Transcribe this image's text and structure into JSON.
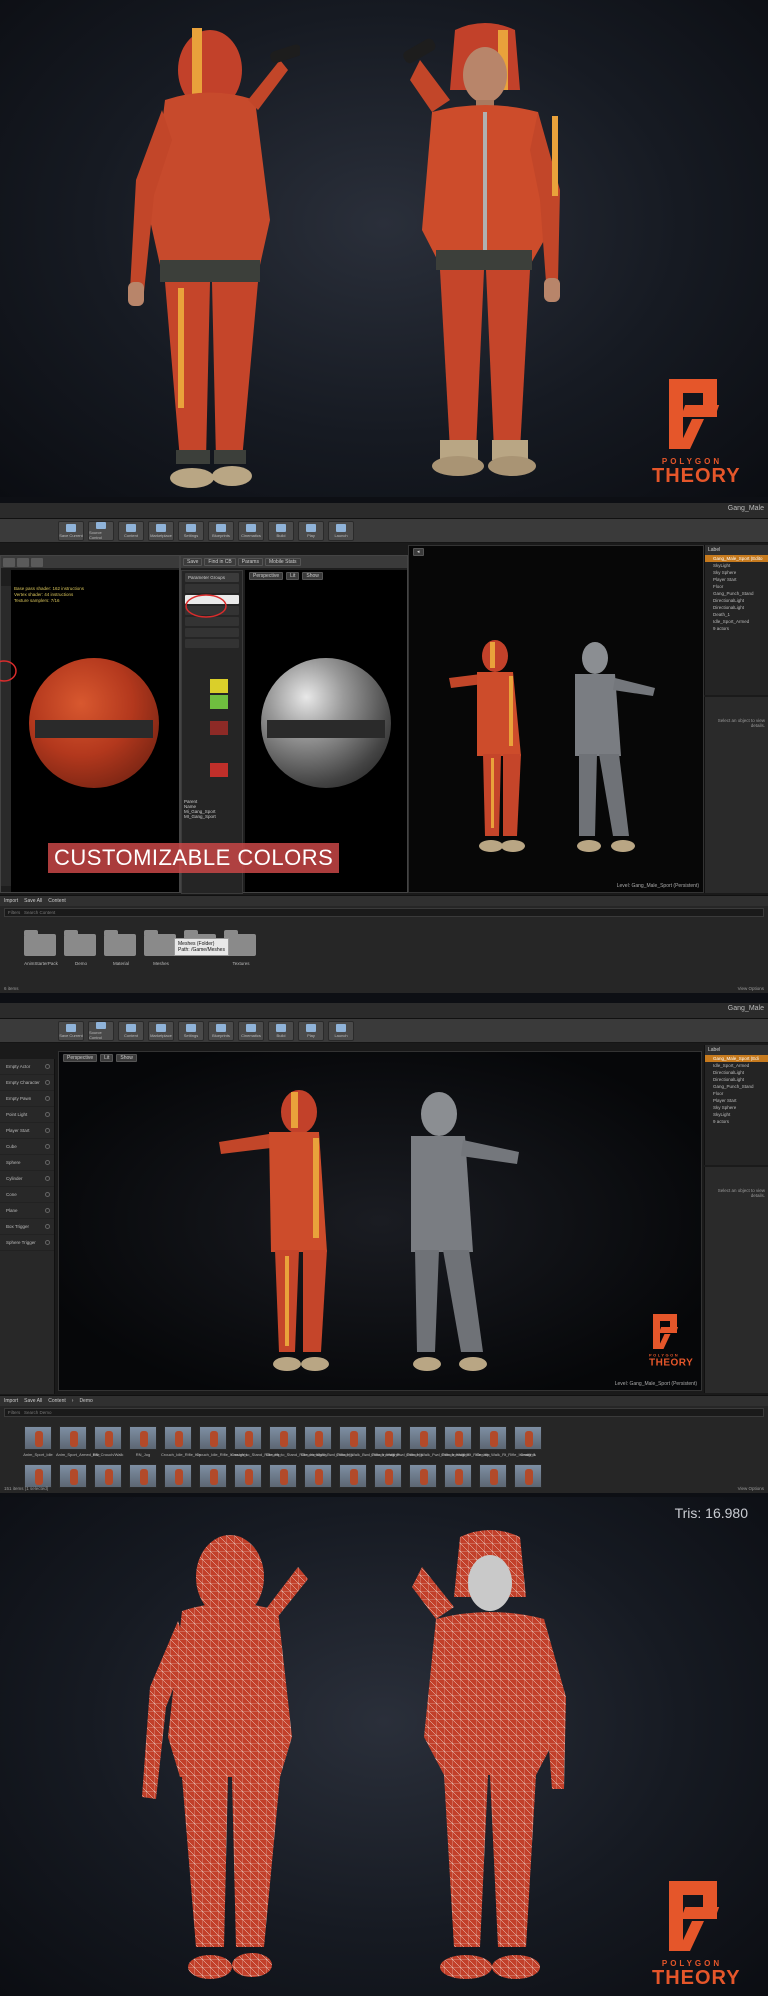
{
  "brand": {
    "line1": "POLYGON",
    "line2": "THEORY",
    "accent": "#e5562a"
  },
  "panel2": {
    "editor_title": "Gang_Male",
    "toolbar": [
      "Save Current",
      "Source Control",
      "Content",
      "Marketplace",
      "Settings",
      "Blueprints",
      "Cinematics",
      "Build",
      "Play",
      "Launch"
    ],
    "mat_left": {
      "tabs": [
        "Perspective",
        "Lit",
        "Show"
      ],
      "stats": [
        "Base pass shader: 162 instructions",
        "Vertex shader: 44 instructions",
        "Texture samplers: 7/16"
      ]
    },
    "mat_mid": {
      "toolbar": [
        "Save",
        "Find in CB",
        "Params",
        "Mobile Stats"
      ],
      "section": "Parameter Groups",
      "params": [
        "Parent",
        "Name",
        "Mi_Gang_Sport",
        "MI_Gang_Sport"
      ]
    },
    "mat_right": {
      "tabs": [
        "Perspective",
        "Lit",
        "Show"
      ]
    },
    "overlay_label": "CUSTOMIZABLE COLORS",
    "level": "Level: Gang_Male_Sport (Persistent)",
    "outliner": {
      "header": "Label",
      "items": [
        "Gang_Male_Sport (Edito",
        "SkyLight",
        "Sky Sphere",
        "Player Start",
        "Floor",
        "Gang_Punch_Stand",
        "DirectionalLight",
        "DirectionalLight",
        "Death_1",
        "Idle_Sport_Armed"
      ],
      "count": "9 actors"
    },
    "details_hint": "Select an object to view details.",
    "content_browser": {
      "tab": "Import",
      "save": "Save All",
      "path": "Content",
      "filters": "Filters",
      "search": "Search Content",
      "folders": [
        "AnimStarterPack",
        "Demo",
        "Material",
        "Meshes",
        "",
        "Textures"
      ],
      "tooltip_title": "Meshes (Folder)",
      "tooltip_path": "Path: /Game/Meshes",
      "footer": "6 items",
      "view": "View Options"
    }
  },
  "panel3": {
    "editor_title": "Gang_Male",
    "toolbar": [
      "Save Current",
      "Source Control",
      "Content",
      "Marketplace",
      "Settings",
      "Blueprints",
      "Cinematics",
      "Build",
      "Play",
      "Launch"
    ],
    "place_items": [
      "Empty Actor",
      "Empty Character",
      "Empty Pawn",
      "Point Light",
      "Player Start",
      "Cube",
      "Sphere",
      "Cylinder",
      "Cone",
      "Plane",
      "Box Trigger",
      "Sphere Trigger"
    ],
    "viewport_tabs": [
      "Perspective",
      "Lit",
      "Show"
    ],
    "level": "Level: Gang_Male_Sport (Persistent)",
    "outliner": {
      "header": "Label",
      "items": [
        "Gang_Male_Sport (Edi",
        "Idle_Sport_Armed",
        "DirectionalLight",
        "DirectionalLight",
        "Gang_Punch_Stand",
        "Floor",
        "Player Start",
        "Sky Sphere",
        "SkyLight"
      ],
      "count": "9 actors"
    },
    "details_hint": "Select an object to view details.",
    "content_browser": {
      "tab": "Import",
      "save": "Save All",
      "path": [
        "Content",
        "Demo"
      ],
      "filters": "Filters",
      "search": "Search Demo",
      "anims_row1": [
        "Anim_Sport_Idle",
        "Anim_Sport_Armed_Idle",
        "RN_Crouch/Walk",
        "RN_Jog",
        "Crouch_Idle_Rifle_Hip",
        "Crouch_Idle_Rifle_Ironsights",
        "Crouch_to_Stand_Rifle_Hip",
        "Crouch_to_Stand_Rifle_Ironsights",
        "Crouch_Walk_Bwd_Rifle_Hip",
        "Crouch_Walk_Bwd_Rifle_Ironsights",
        "Crouch_Walk_Fwd_Rifle_Hip",
        "Crouch_Walk_Fwd_Rifle_Ironsights",
        "Crouch_Walk_Rt_Rifle_Hip",
        "Crouch_Walk_Rt_Rifle_Ironsights",
        "Death_1"
      ],
      "footer": "151 items (1 selected)",
      "view": "View Options"
    }
  },
  "panel4": {
    "tris": "Tris: 16.980"
  }
}
